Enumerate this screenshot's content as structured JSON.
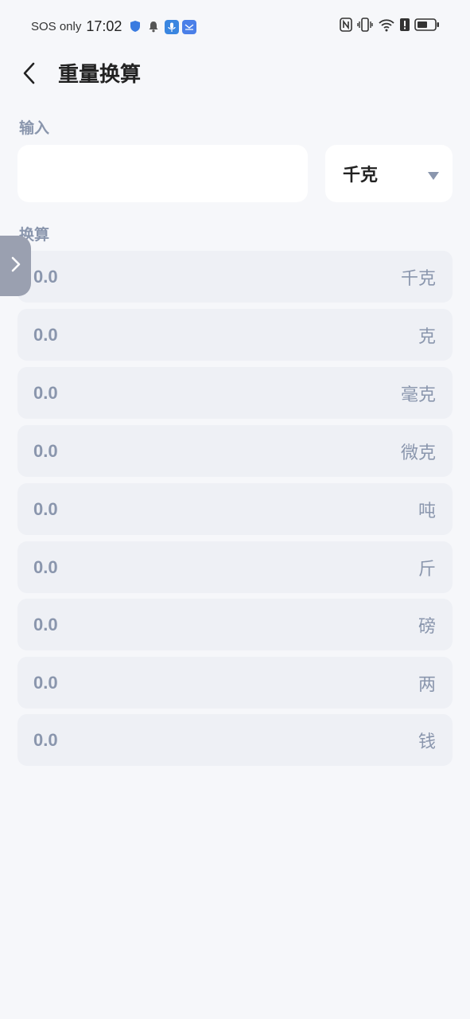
{
  "status_bar": {
    "carrier": "SOS only",
    "time": "17:02"
  },
  "header": {
    "title": "重量换算"
  },
  "input_section": {
    "label": "输入",
    "value": "",
    "selected_unit": "千克"
  },
  "result_section": {
    "label": "换算",
    "rows": [
      {
        "value": "0.0",
        "unit": "千克"
      },
      {
        "value": "0.0",
        "unit": "克"
      },
      {
        "value": "0.0",
        "unit": "毫克"
      },
      {
        "value": "0.0",
        "unit": "微克"
      },
      {
        "value": "0.0",
        "unit": "吨"
      },
      {
        "value": "0.0",
        "unit": "斤"
      },
      {
        "value": "0.0",
        "unit": "磅"
      },
      {
        "value": "0.0",
        "unit": "两"
      },
      {
        "value": "0.0",
        "unit": "钱"
      }
    ]
  },
  "icons": {
    "back": "chevron-left-icon",
    "dropdown": "triangle-down-icon",
    "side_handle": "chevron-right-icon"
  },
  "colors": {
    "background": "#f6f7fa",
    "row_background": "#eef0f5",
    "muted_text": "#8a96ad",
    "handle": "#9aa0b0"
  }
}
